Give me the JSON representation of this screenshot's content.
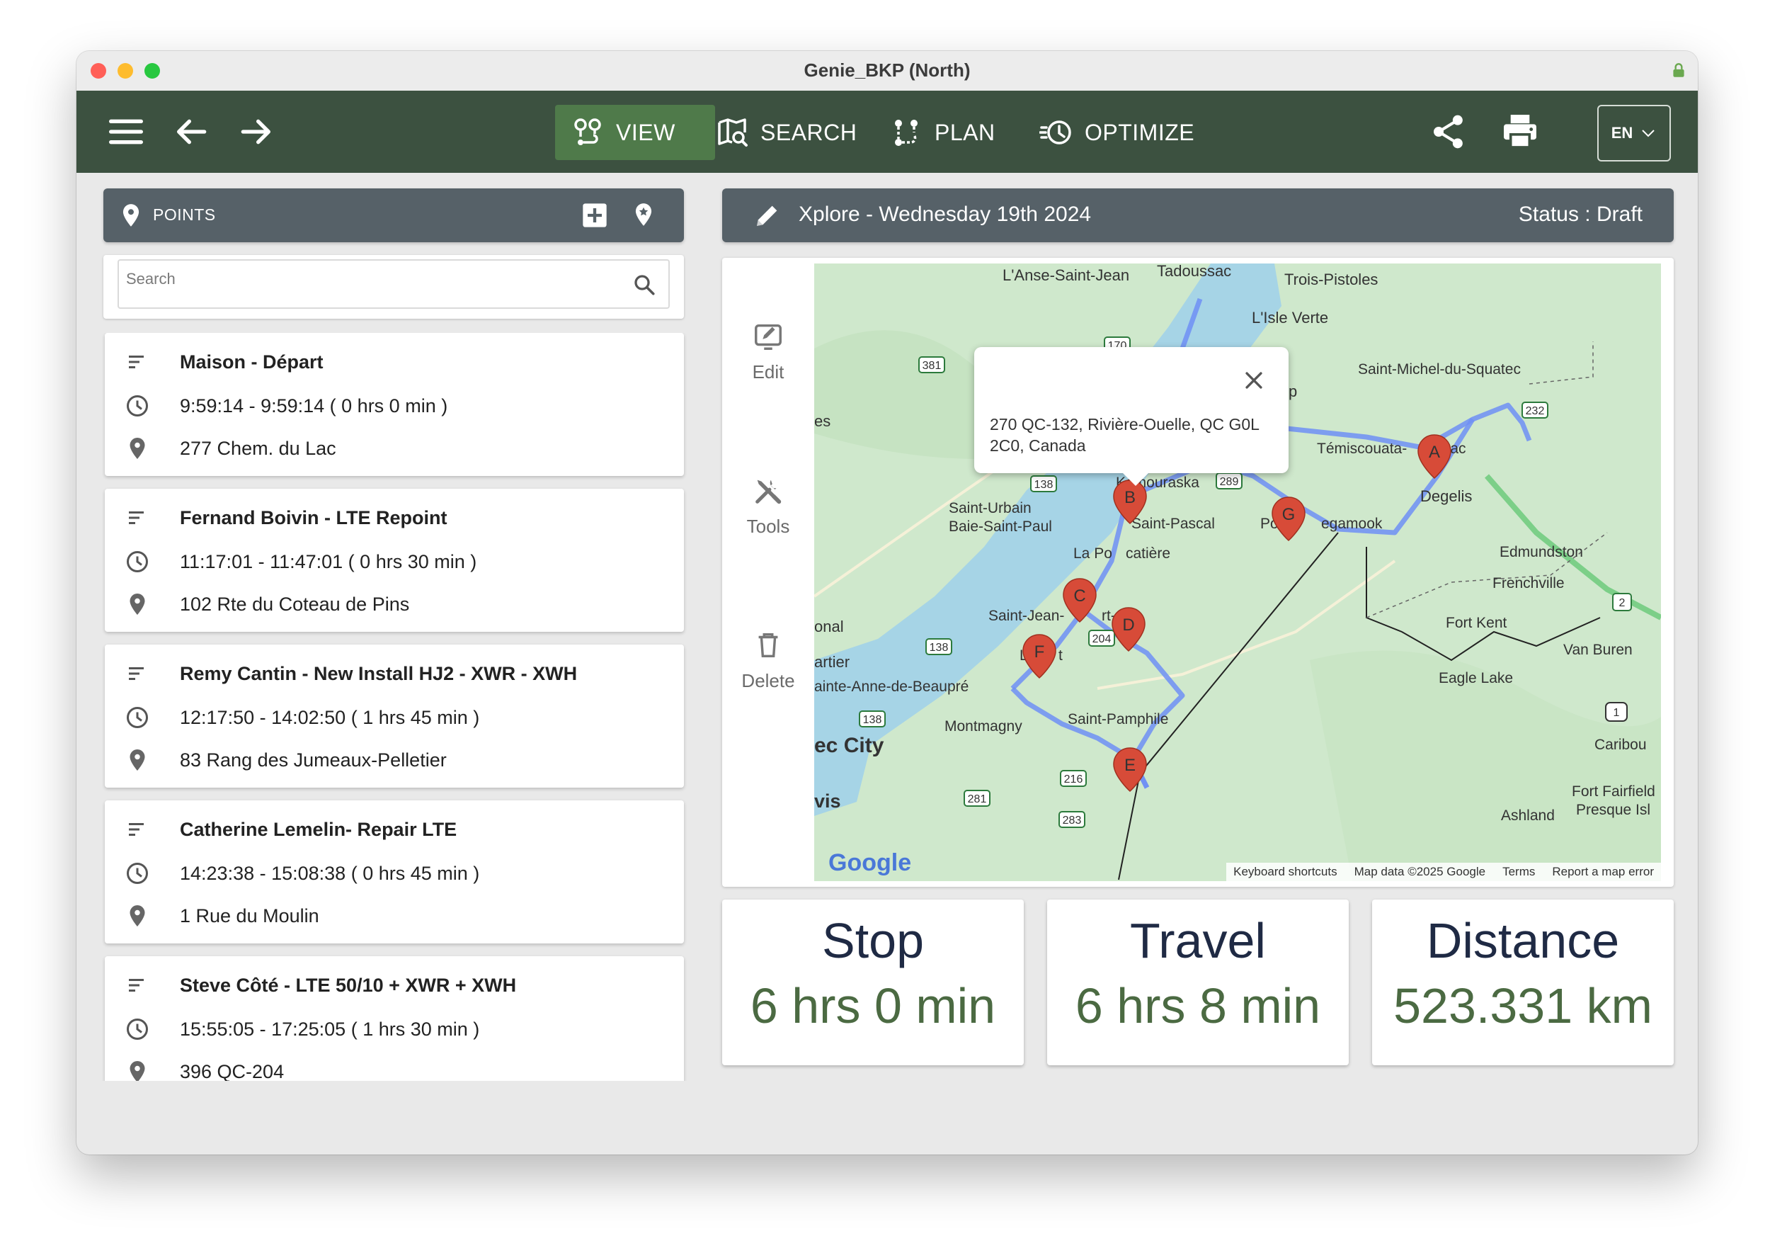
{
  "window": {
    "title": "Genie_BKP (North)"
  },
  "nav": {
    "tabs": [
      {
        "label": "VIEW",
        "icon": "route-view-icon",
        "active": true
      },
      {
        "label": "SEARCH",
        "icon": "map-search-icon",
        "active": false
      },
      {
        "label": "PLAN",
        "icon": "route-plan-icon",
        "active": false
      },
      {
        "label": "OPTIMIZE",
        "icon": "clock-optimize-icon",
        "active": false
      }
    ],
    "language": "EN"
  },
  "points_panel": {
    "header": "POINTS",
    "search_placeholder": "Search",
    "stops": [
      {
        "name": "Maison - Départ",
        "time": "9:59:14 - 9:59:14 ( 0 hrs 0 min )",
        "address": "277 Chem. du Lac"
      },
      {
        "name": "Fernand Boivin - LTE Repoint",
        "time": "11:17:01 - 11:47:01 ( 0 hrs 30 min )",
        "address": "102 Rte du Coteau de Pins"
      },
      {
        "name": "Remy Cantin - New Install HJ2 - XWR - XWH",
        "time": "12:17:50 - 14:02:50 ( 1 hrs 45 min )",
        "address": "83 Rang des Jumeaux-Pelletier"
      },
      {
        "name": "Catherine Lemelin- Repair LTE",
        "time": "14:23:38 - 15:08:38 ( 0 hrs 45 min )",
        "address": "1 Rue du Moulin"
      },
      {
        "name": "Steve Côté - LTE 50/10 + XWR + XWH",
        "time": "15:55:05 - 17:25:05 ( 1 hrs 30 min )",
        "address": "396 QC-204"
      }
    ]
  },
  "route_header": {
    "title": "Xplore - Wednesday 19th 2024",
    "status": "Status : Draft"
  },
  "map_tools": {
    "edit": "Edit",
    "tools": "Tools",
    "delete": "Delete"
  },
  "map": {
    "popup_address": "270 QC-132, Rivière-Ouelle, QC G0L 2C0, Canada",
    "attribution": {
      "shortcuts": "Keyboard shortcuts",
      "data": "Map data ©2025 Google",
      "terms": "Terms",
      "report": "Report a map error"
    },
    "logo": "Google",
    "markers": [
      "A",
      "B",
      "C",
      "D",
      "E",
      "F",
      "G"
    ],
    "place_labels": {
      "l1": "L'Anse-Saint-Jean",
      "l2": "Tadoussac",
      "l3": "Trois-Pistoles",
      "l4": "L'Isle Verte",
      "l5": "Saint-Michel-du-Squatec",
      "l6": "Témiscouata-",
      "l7": "e-Lac",
      "l8": "Degelis",
      "l9": "Kamouraska",
      "l10": "Saint-Pascal",
      "l11": "Saint-Urbain",
      "l12": "Baie-Saint-Paul",
      "l13": "Po",
      "l14": "egamook",
      "l15": "La Po",
      "l16": "catière",
      "l17": "Edmundston",
      "l18": "Frenchville",
      "l19": "Saint-Jean-",
      "l20": "rt-Joli",
      "l21": "Fort Kent",
      "l22": "Van Buren",
      "l23": "onal",
      "l24": "artier",
      "l25": "ainte-Anne-de-Beaupré",
      "l26": "Eagle Lake",
      "l27": "Montmagny",
      "l28": "Saint-Pamphile",
      "l29": "Caribou",
      "l30": "ec City",
      "l31": "Fort Fairfield",
      "l32": "Presque Isl",
      "l33": "Ashland",
      "l34": "vis",
      "l35": "es",
      "l36": "p",
      "l37": "L",
      "l38": "t"
    },
    "route_shields": {
      "s1": "170",
      "s2": "381",
      "s3": "232",
      "s4": "289",
      "s5": "138",
      "s6": "138",
      "s7": "204",
      "s8": "138",
      "s9": "216",
      "s10": "281",
      "s11": "283",
      "s12": "2",
      "s13": "1"
    },
    "colors": {
      "water": "#a6d4e6",
      "land": "#cfe8cc",
      "route": "#6f8ff5",
      "marker": "#d74b38"
    }
  },
  "stats": [
    {
      "label": "Stop",
      "value": "6 hrs 0 min"
    },
    {
      "label": "Travel",
      "value": "6 hrs 8 min"
    },
    {
      "label": "Distance",
      "value": "523.331 km"
    }
  ]
}
